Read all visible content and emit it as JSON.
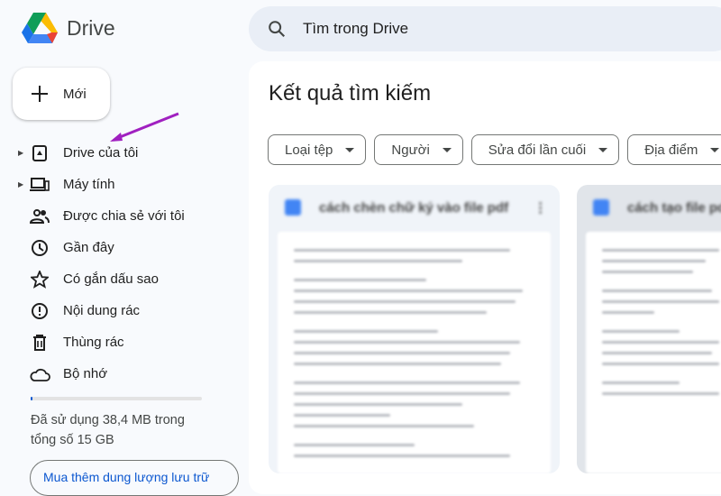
{
  "app": {
    "name": "Drive"
  },
  "search": {
    "placeholder": "Tìm trong Drive"
  },
  "new_button": "Mới",
  "nav": [
    {
      "label": "Drive của tôi",
      "icon": "my-drive-icon",
      "expandable": true
    },
    {
      "label": "Máy tính",
      "icon": "computer-icon",
      "expandable": true
    },
    {
      "label": "Được chia sẻ với tôi",
      "icon": "shared-icon"
    },
    {
      "label": "Gần đây",
      "icon": "clock-icon"
    },
    {
      "label": "Có gắn dấu sao",
      "icon": "star-icon"
    },
    {
      "label": "Nội dung rác",
      "icon": "spam-icon"
    },
    {
      "label": "Thùng rác",
      "icon": "trash-icon"
    },
    {
      "label": "Bộ nhớ",
      "icon": "cloud-icon"
    }
  ],
  "storage": {
    "text": "Đã sử dụng 38,4 MB trong tổng số 15 GB",
    "used_fraction": 0.0025,
    "buy_label": "Mua thêm dung lượng lưu trữ"
  },
  "main": {
    "title": "Kết quả tìm kiếm",
    "filters": [
      "Loại tệp",
      "Người",
      "Sửa đổi lần cuối",
      "Địa điểm"
    ],
    "results": [
      {
        "title": "cách chèn chữ ký vào file pdf"
      },
      {
        "title": "cách tạo file pdf"
      }
    ]
  },
  "colors": {
    "accent": "#0b57d0",
    "annotation_arrow": "#a020c0"
  }
}
